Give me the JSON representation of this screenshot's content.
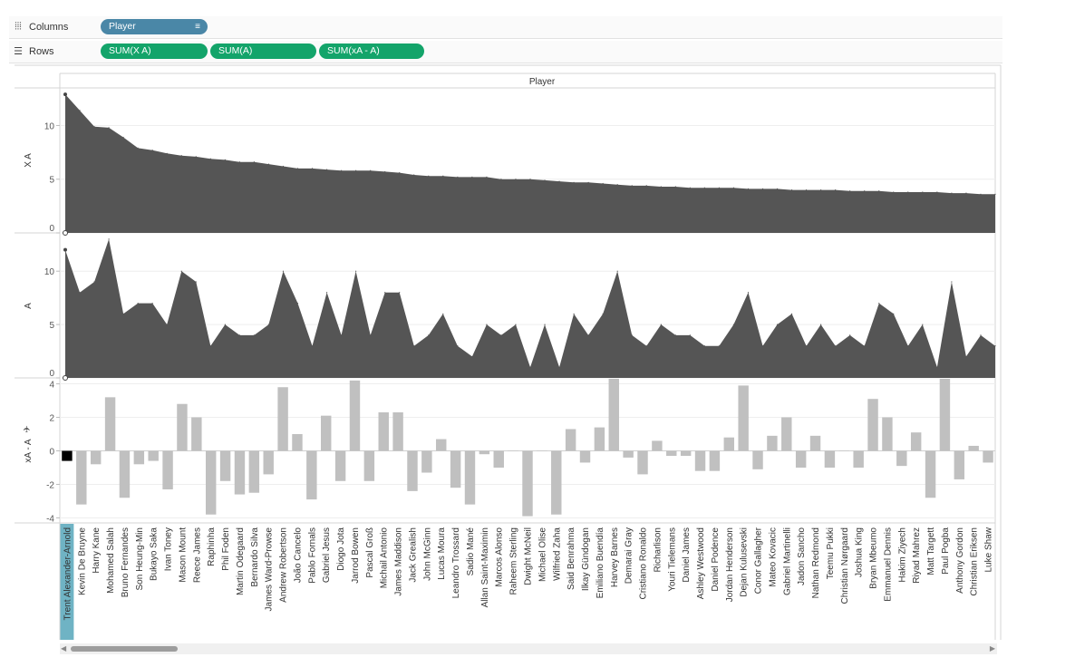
{
  "shelves": {
    "columns": {
      "label": "Columns",
      "icon": "columns-icon",
      "pills": [
        {
          "label": "Player"
        }
      ]
    },
    "rows": {
      "label": "Rows",
      "icon": "rows-icon",
      "pills": [
        {
          "label": "SUM(X A)"
        },
        {
          "label": "SUM(A)"
        },
        {
          "label": "SUM(xA - A)"
        }
      ]
    }
  },
  "colors": {
    "area": "#555555",
    "bar": "#c0c0c0",
    "highlight": "#000000",
    "pill_blue": "#4a87a7",
    "pill_green": "#13a46a",
    "selected_label_bg": "#6fb3c4"
  },
  "chart_data": {
    "header_title": "Player",
    "categories": [
      "Trent Alexander-Arnold",
      "Kevin De Bruyne",
      "Harry Kane",
      "Mohamed Salah",
      "Bruno Fernandes",
      "Son Heung-Min",
      "Bukayo Saka",
      "Ivan Toney",
      "Mason Mount",
      "Reece James",
      "Raphinha",
      "Phil Foden",
      "Martin Odegaard",
      "Bernardo Silva",
      "James Ward-Prowse",
      "Andrew Robertson",
      "João Cancelo",
      "Pablo Fornals",
      "Gabriel Jesus",
      "Diogo Jota",
      "Jarrod Bowen",
      "Pascal Groß",
      "Michail Antonio",
      "James Maddison",
      "Jack Grealish",
      "John McGinn",
      "Lucas Moura",
      "Leandro Trossard",
      "Sadio Mané",
      "Allan Saint-Maximin",
      "Marcos Alonso",
      "Raheem Sterling",
      "Dwight McNeil",
      "Michael Olise",
      "Wilfried Zaha",
      "Said Benrahma",
      "Ilkay Gündogan",
      "Emiliano Buendía",
      "Harvey Barnes",
      "Demarai Gray",
      "Cristiano Ronaldo",
      "Richarlison",
      "Youri Tielemans",
      "Daniel James",
      "Ashley Westwood",
      "Daniel Podence",
      "Jordan Henderson",
      "Dejan Kulusevski",
      "Conor Gallagher",
      "Mateo Kovacic",
      "Gabriel Martinelli",
      "Jadon Sancho",
      "Nathan Redmond",
      "Teemu Pukki",
      "Christian Nørgaard",
      "Joshua King",
      "Bryan Mbeumo",
      "Emmanuel Dennis",
      "Hakim Ziyech",
      "Riyad Mahrez",
      "Matt Targett",
      "Paul Pogba",
      "Anthony Gordon",
      "Christian Eriksen",
      "Luke Shaw"
    ],
    "selected_category": "Trent Alexander-Arnold",
    "panels": [
      {
        "type": "area",
        "ylabel": "X A",
        "ylim": [
          0,
          13.5
        ],
        "ticks": [
          0,
          5,
          10
        ],
        "values": [
          12.9,
          11.4,
          9.9,
          9.8,
          8.9,
          7.9,
          7.7,
          7.4,
          7.2,
          7.1,
          6.9,
          6.8,
          6.6,
          6.6,
          6.4,
          6.2,
          6.0,
          6.0,
          5.9,
          5.8,
          5.8,
          5.8,
          5.7,
          5.6,
          5.4,
          5.3,
          5.3,
          5.2,
          5.2,
          5.2,
          5.0,
          5.0,
          5.0,
          4.9,
          4.8,
          4.7,
          4.7,
          4.6,
          4.5,
          4.4,
          4.4,
          4.3,
          4.3,
          4.2,
          4.2,
          4.2,
          4.2,
          4.1,
          4.1,
          4.1,
          4.0,
          4.0,
          4.0,
          4.0,
          3.9,
          3.9,
          3.9,
          3.8,
          3.8,
          3.8,
          3.8,
          3.7,
          3.7,
          3.6,
          3.6
        ]
      },
      {
        "type": "area",
        "ylabel": "A",
        "ylim": [
          0,
          13.5
        ],
        "ticks": [
          0,
          5,
          10
        ],
        "values": [
          12,
          8,
          9,
          13,
          6,
          7,
          7,
          5,
          10,
          9,
          3,
          5,
          4,
          4,
          5,
          10,
          7,
          3,
          8,
          4,
          10,
          4,
          8,
          8,
          3,
          4,
          6,
          3,
          2,
          5,
          4,
          5,
          1,
          5,
          1,
          6,
          4,
          6,
          10,
          4,
          3,
          5,
          4,
          4,
          3,
          3,
          5,
          8,
          3,
          5,
          6,
          3,
          5,
          3,
          4,
          3,
          7,
          6,
          3,
          5,
          1,
          9,
          2,
          4,
          3
        ]
      },
      {
        "type": "bar",
        "ylabel": "xA - A",
        "ylim": [
          -4.3,
          4.3
        ],
        "ticks": [
          -4,
          -2,
          0,
          2,
          4
        ],
        "values": [
          -0.6,
          -3.2,
          -0.8,
          3.2,
          -2.8,
          -0.8,
          -0.6,
          -2.3,
          2.8,
          2.0,
          -3.8,
          -1.8,
          -2.6,
          -2.5,
          -1.4,
          3.8,
          1.0,
          -2.9,
          2.1,
          -1.8,
          4.2,
          -1.8,
          2.3,
          2.3,
          -2.4,
          -1.3,
          0.7,
          -2.2,
          -3.2,
          -0.2,
          -1.0,
          0.0,
          -3.9,
          0.0,
          -3.8,
          1.3,
          -0.7,
          1.4,
          4.3,
          -0.4,
          -1.4,
          0.6,
          -0.3,
          -0.3,
          -1.2,
          -1.2,
          0.8,
          3.9,
          -1.1,
          0.9,
          2.0,
          -1.0,
          0.9,
          -1.0,
          0.0,
          -1.0,
          3.1,
          2.0,
          -0.9,
          1.1,
          -2.8,
          4.3,
          -1.7,
          0.3,
          -0.7
        ]
      }
    ]
  }
}
